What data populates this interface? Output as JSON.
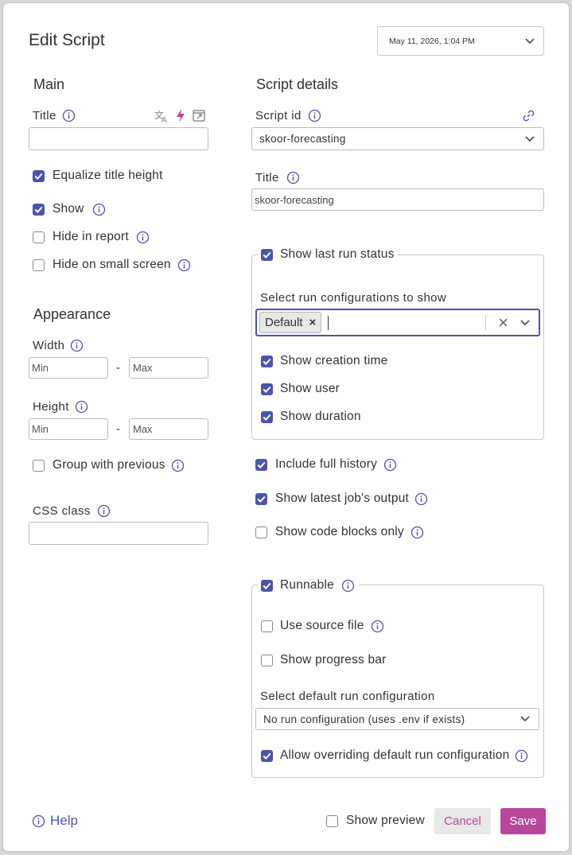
{
  "header": {
    "title": "Edit Script",
    "date_value": "May 11, 2026, 1:04 PM"
  },
  "main": {
    "section_title": "Main",
    "title_label": "Title",
    "title_value": "",
    "equalize_label": "Equalize title height",
    "show_label": "Show",
    "hide_report_label": "Hide in report",
    "hide_small_label": "Hide on small screen"
  },
  "appearance": {
    "section_title": "Appearance",
    "width_label": "Width",
    "height_label": "Height",
    "min_placeholder": "Min",
    "max_placeholder": "Max",
    "dash": "-",
    "group_label": "Group with previous",
    "css_label": "CSS class",
    "css_value": ""
  },
  "details": {
    "section_title": "Script details",
    "script_id_label": "Script id",
    "script_id_value": "skoor-forecasting",
    "title_label": "Title",
    "title_value": "skoor-forecasting"
  },
  "last_run": {
    "legend": "Show last run status",
    "select_label": "Select run configurations to show",
    "tag": "Default",
    "tag_remove": "×",
    "clear": "×",
    "creation_label": "Show creation time",
    "user_label": "Show user",
    "duration_label": "Show duration"
  },
  "options": {
    "full_history_label": "Include full history",
    "latest_output_label": "Show latest job's output",
    "code_blocks_label": "Show code blocks only"
  },
  "runnable": {
    "legend": "Runnable",
    "source_file_label": "Use source file",
    "progress_label": "Show progress bar",
    "default_config_label": "Select default run configuration",
    "default_config_value": "No run configuration (uses .env if exists)",
    "override_label": "Allow overriding default run configuration"
  },
  "footer": {
    "help_label": "Help",
    "preview_label": "Show preview",
    "cancel_label": "Cancel",
    "save_label": "Save"
  },
  "colors": {
    "accent": "#4b55a8",
    "brand": "#b8479b",
    "cancel_bg": "#e8e8e8"
  },
  "icons": [
    "info-icon",
    "translate-icon",
    "bolt-icon",
    "open-window-icon",
    "link-icon",
    "chevron-down-icon",
    "check-icon",
    "close-icon"
  ]
}
